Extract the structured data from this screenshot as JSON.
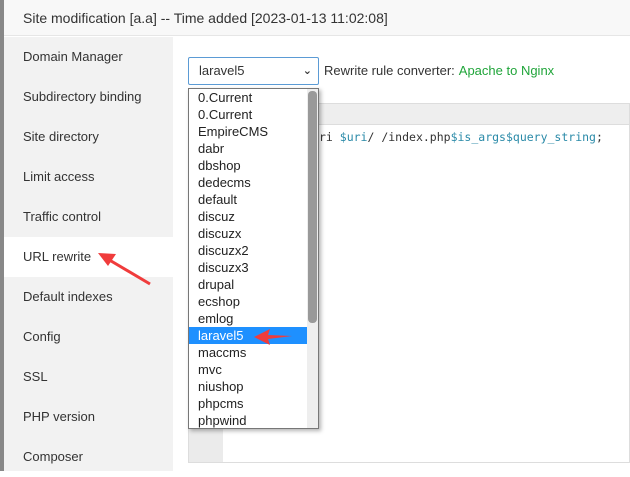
{
  "title": "Site modification [a.a] -- Time added [2023-01-13 11:02:08]",
  "sidebar": {
    "items": [
      {
        "label": "Domain Manager"
      },
      {
        "label": "Subdirectory binding"
      },
      {
        "label": "Site directory"
      },
      {
        "label": "Limit access"
      },
      {
        "label": "Traffic control"
      },
      {
        "label": "URL rewrite",
        "active": true
      },
      {
        "label": "Default indexes"
      },
      {
        "label": "Config"
      },
      {
        "label": "SSL"
      },
      {
        "label": "PHP version"
      },
      {
        "label": "Composer"
      }
    ]
  },
  "rewrite": {
    "selected": "laravel5",
    "converter_label": "Rewrite rule converter:",
    "converter_link": "Apache to Nginx",
    "code_prefix": "ri ",
    "code_var1": "$uri",
    "code_mid": "/ /index.php",
    "code_var2": "$is_args$query_string",
    "code_end": ";"
  },
  "options": [
    "0.Current",
    "0.Current",
    "EmpireCMS",
    "dabr",
    "dbshop",
    "dedecms",
    "default",
    "discuz",
    "discuzx",
    "discuzx2",
    "discuzx3",
    "drupal",
    "ecshop",
    "emlog",
    "laravel5",
    "maccms",
    "mvc",
    "niushop",
    "phpcms",
    "phpwind"
  ],
  "colors": {
    "accent": "#20a53a",
    "selection": "#1e90ff",
    "annotation": "#f03c3c"
  }
}
